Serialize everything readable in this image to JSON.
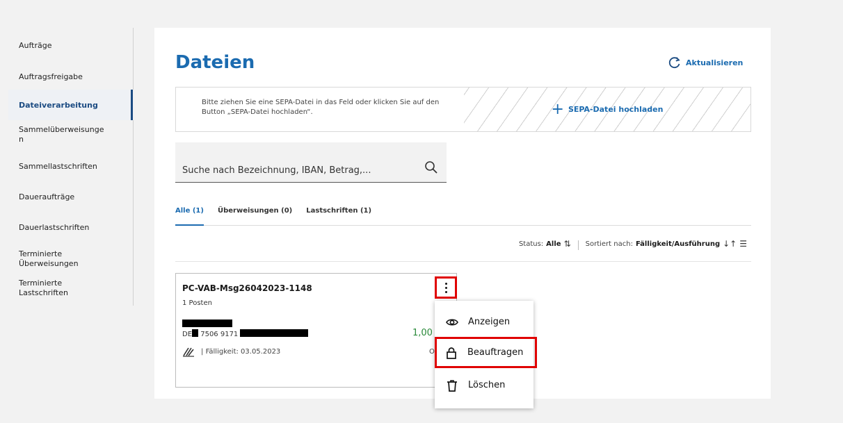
{
  "sidebar": {
    "items": [
      {
        "label": "Aufträge"
      },
      {
        "label": "Auftragsfreigabe"
      },
      {
        "label": "Dateiverarbeitung"
      },
      {
        "label": "Sammelüberweisunge\nn"
      },
      {
        "label": "Sammellastschriften"
      },
      {
        "label": "Daueraufträge"
      },
      {
        "label": "Dauerlastschriften"
      },
      {
        "label": "Terminierte\nÜberweisungen"
      },
      {
        "label": "Terminierte\nLastschriften"
      }
    ]
  },
  "main": {
    "title": "Dateien",
    "refresh_label": "Aktualisieren",
    "dropzone": {
      "hint": "Bitte ziehen Sie eine SEPA-Datei in das Feld oder klicken Sie auf den Button „SEPA-Datei hochladen“.",
      "upload_label": "SEPA-Datei hochladen"
    },
    "search": {
      "placeholder": "Suche nach Bezeichnung, IBAN, Betrag,..."
    },
    "tabs": [
      {
        "label": "Alle (1)",
        "active": true
      },
      {
        "label": "Überweisungen (0)"
      },
      {
        "label": "Lastschriften (1)"
      }
    ],
    "filter": {
      "status_label": "Status:",
      "status_value": "Alle",
      "sort_label": "Sortiert nach:",
      "sort_value": "Fälligkeit/Ausführung"
    },
    "file": {
      "name": "PC-VAB-Msg26042023-1148",
      "count": "1 Posten",
      "iban_prefix": "DE",
      "iban_middle": "7506 9171",
      "amount": "1,00",
      "due": "Fälligkeit: 03.05.2023",
      "due_extra": "O"
    }
  },
  "menu": {
    "items": [
      {
        "label": "Anzeigen",
        "icon": "eye-icon"
      },
      {
        "label": "Beauftragen",
        "icon": "lock-icon"
      },
      {
        "label": "Löschen",
        "icon": "trash-icon"
      }
    ]
  },
  "colors": {
    "accent": "#1b6bb0",
    "highlight": "#e00000",
    "amount": "#2a8a3a"
  }
}
